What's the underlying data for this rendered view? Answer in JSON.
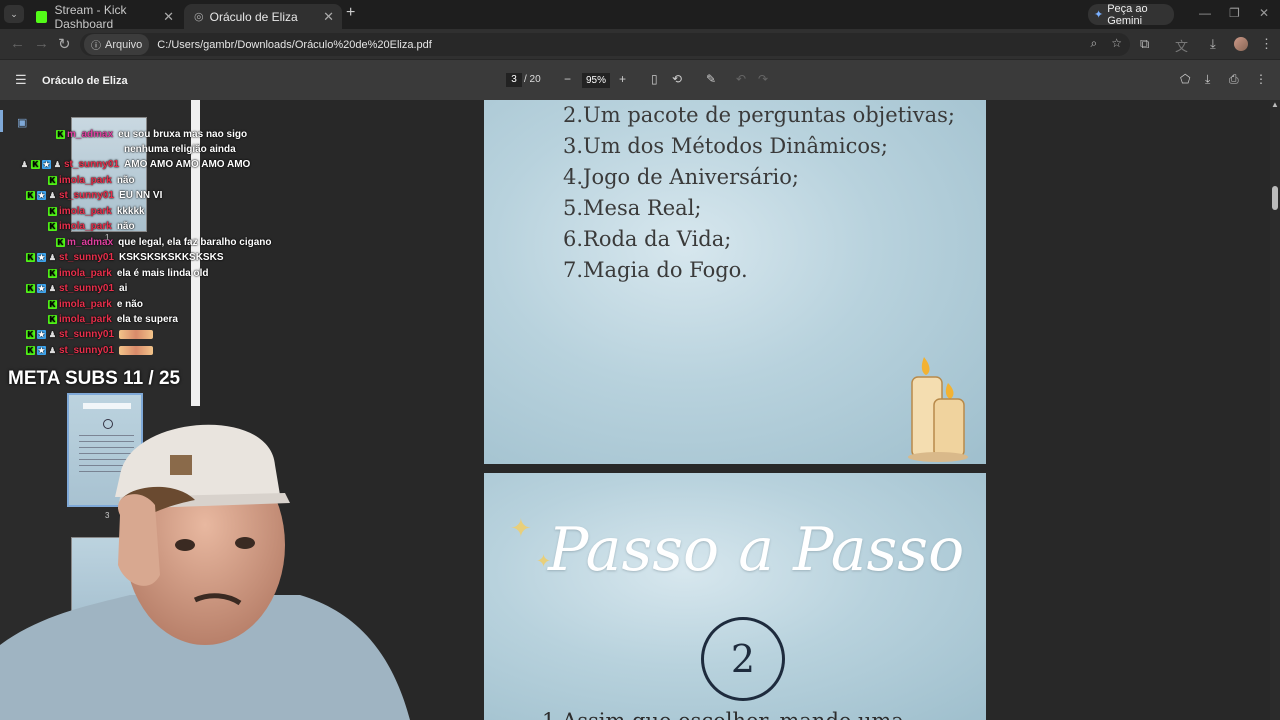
{
  "browser": {
    "tabs": [
      {
        "title": "Stream - Kick Dashboard",
        "active": false
      },
      {
        "title": "Oráculo de Eliza",
        "active": true
      }
    ],
    "gemini_label": "Peça ao Gemini",
    "chip_label": "Arquivo",
    "url": "C:/Users/gambr/Downloads/Oráculo%20de%20Eliza.pdf"
  },
  "pdf_toolbar": {
    "title": "Oráculo de Eliza",
    "current_page": "3",
    "total_pages": "/ 20",
    "zoom": "95%"
  },
  "sidebar": {
    "thumb_number": "3",
    "thumb_number_top": "1"
  },
  "page_top": {
    "items": [
      "2.Um pacote de perguntas objetivas;",
      "3.Um dos Métodos Dinâmicos;",
      "4.Jogo de Aniversário;",
      "5.Mesa Real;",
      "6.Roda da Vida;",
      "7.Magia do Fogo."
    ]
  },
  "page_bottom": {
    "title": "Passo a Passo",
    "step": "2",
    "text": "1.Assim que escolher, mande uma"
  },
  "chat": {
    "messages": [
      {
        "user": "m_admax",
        "user_color": "#e040a0",
        "text": "eu sou bruxa mas nao sigo",
        "badges": [
          "k"
        ]
      },
      {
        "user": "",
        "user_color": "#e040a0",
        "text": "nenhuma religião ainda",
        "badges": []
      },
      {
        "user": "st_sunny01",
        "user_color": "#e8304c",
        "text": "AMO AMO AMO AMO AMO",
        "badges": [
          "m",
          "k",
          "s",
          "m"
        ]
      },
      {
        "user": "imola_park",
        "user_color": "#e8304c",
        "text": "não",
        "badges": [
          "k"
        ]
      },
      {
        "user": "st_sunny01",
        "user_color": "#e8304c",
        "text": "EU NN VI",
        "badges": [
          "k",
          "s",
          "m"
        ]
      },
      {
        "user": "imola_park",
        "user_color": "#e8304c",
        "text": "kkkkk",
        "badges": [
          "k"
        ]
      },
      {
        "user": "imola_park",
        "user_color": "#e8304c",
        "text": "não",
        "badges": [
          "k"
        ]
      },
      {
        "user": "m_admax",
        "user_color": "#e040a0",
        "text": "que legal, ela faz baralho cigano",
        "badges": [
          "k"
        ]
      },
      {
        "user": "st_sunny01",
        "user_color": "#e8304c",
        "text": "KSKSKSKSKKSKSKS",
        "badges": [
          "k",
          "s",
          "m"
        ]
      },
      {
        "user": "imola_park",
        "user_color": "#e8304c",
        "text": "ela é mais linda old",
        "badges": [
          "k"
        ]
      },
      {
        "user": "st_sunny01",
        "user_color": "#e8304c",
        "text": "ai",
        "badges": [
          "k",
          "s",
          "m"
        ]
      },
      {
        "user": "imola_park",
        "user_color": "#e8304c",
        "text": "e não",
        "badges": [
          "k"
        ]
      },
      {
        "user": "imola_park",
        "user_color": "#e8304c",
        "text": "ela te supera",
        "badges": [
          "k"
        ]
      },
      {
        "user": "st_sunny01",
        "user_color": "#e8304c",
        "text": "",
        "badges": [
          "k",
          "s",
          "m"
        ]
      },
      {
        "user": "st_sunny01",
        "user_color": "#e8304c",
        "text": "",
        "badges": [
          "k",
          "s",
          "m"
        ]
      }
    ],
    "meta_subs": "META SUBS 11 / 25"
  }
}
